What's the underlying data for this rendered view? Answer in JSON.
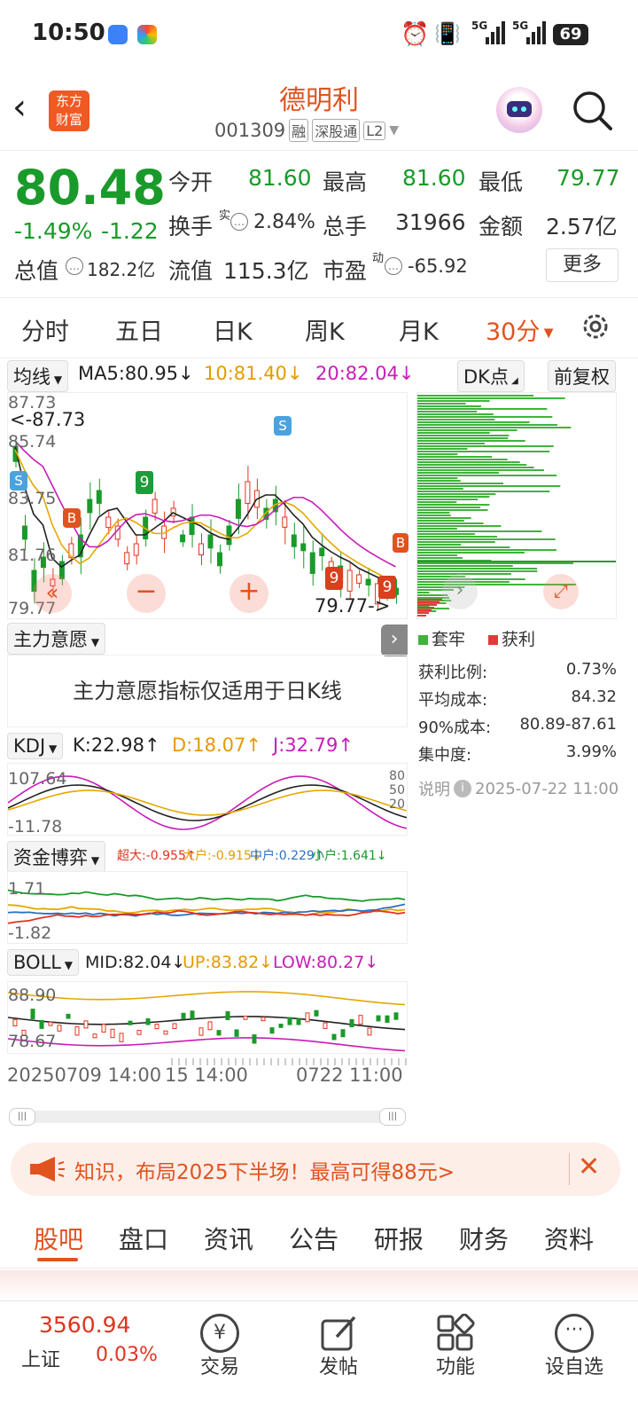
{
  "status": {
    "time": "10:50",
    "battery": "69",
    "net1": "5G",
    "net2": "5G"
  },
  "header": {
    "logo_line1": "东方",
    "logo_line2": "财富",
    "title": "德明利",
    "code": "001309",
    "tag1": "融",
    "tag2": "深股通",
    "tag3": "L2"
  },
  "quote": {
    "price": "80.48",
    "pct": "-1.49%",
    "chg": "-1.22",
    "items": [
      {
        "label": "今开",
        "value": "81.60"
      },
      {
        "label": "最高",
        "value": "81.60"
      },
      {
        "label": "最低",
        "value": "79.77"
      },
      {
        "label": "换手",
        "sup": "实",
        "value": "2.84%"
      },
      {
        "label": "总手",
        "value": "31966"
      },
      {
        "label": "金额",
        "value": "2.57亿"
      },
      {
        "label": "总值",
        "value": "182.2亿"
      },
      {
        "label": "流值",
        "value": "115.3亿"
      },
      {
        "label": "市盈",
        "sup": "动",
        "value": "-65.92"
      }
    ],
    "more": "更多"
  },
  "tabs": [
    "分时",
    "五日",
    "日K",
    "周K",
    "月K",
    "30分"
  ],
  "ma": {
    "label": "均线",
    "ma5": "MA5:80.95↓",
    "ma10": "10:81.40↓",
    "ma20": "20:82.04↓",
    "dk": "DK点",
    "adj": "前复权"
  },
  "main_chart": {
    "y_labels": [
      "87.73",
      "85.74",
      "83.75",
      "81.76",
      "79.77"
    ],
    "high_marker": "<-87.73",
    "low_marker": "79.77->",
    "badge_s": "S",
    "badge_b": "B",
    "badge_9": "9"
  },
  "chip": {
    "legend_trapped": "套牢",
    "legend_profit": "获利",
    "rows": [
      {
        "label": "获利比例:",
        "value": "0.73%"
      },
      {
        "label": "平均成本:",
        "value": "84.32"
      },
      {
        "label": "90%成本:",
        "value": "80.89-87.61"
      },
      {
        "label": "集中度:",
        "value": "3.99%"
      }
    ],
    "note_label": "说明",
    "note_date": "2025-07-22 11:00"
  },
  "zhuli": {
    "label": "主力意愿",
    "message": "主力意愿指标仅适用于日K线"
  },
  "kdj": {
    "label": "KDJ",
    "k": "K:22.98↑",
    "d": "D:18.07↑",
    "j": "J:32.79↑",
    "y_top": "107.64",
    "y_bottom": "-11.78",
    "r80": "80",
    "r50": "50",
    "r20": "20"
  },
  "fund": {
    "label": "资金博弈",
    "super": "超大:-0.955↑",
    "big": "大户:-0.915↓",
    "mid": "中户:0.229↑",
    "small": "小户:1.641↓",
    "y_top": "1.71",
    "y_bottom": "-1.82"
  },
  "boll": {
    "label": "BOLL",
    "mid": "MID:82.04↓",
    "up": "UP:83.82↓",
    "low": "LOW:80.27↓",
    "y_top": "88.90",
    "y_bottom": "78.67"
  },
  "xaxis": {
    "left": "20250709 14:00",
    "mid": "15 14:00",
    "right": "0722 11:00"
  },
  "banner": {
    "text": "知识，布局2025下半场！最高可得88元>"
  },
  "bottom_tabs": [
    "股吧",
    "盘口",
    "资讯",
    "公告",
    "研报",
    "财务",
    "资料"
  ],
  "index": {
    "value": "3560.94",
    "name": "上证",
    "pct": "0.03%"
  },
  "nav": [
    "交易",
    "发帖",
    "功能",
    "设自选"
  ],
  "colors": {
    "accent": "#e0531f",
    "up": "#e0341f",
    "down": "#1a9a2a",
    "ma10": "#e5a800",
    "ma20": "#c81cb8"
  }
}
